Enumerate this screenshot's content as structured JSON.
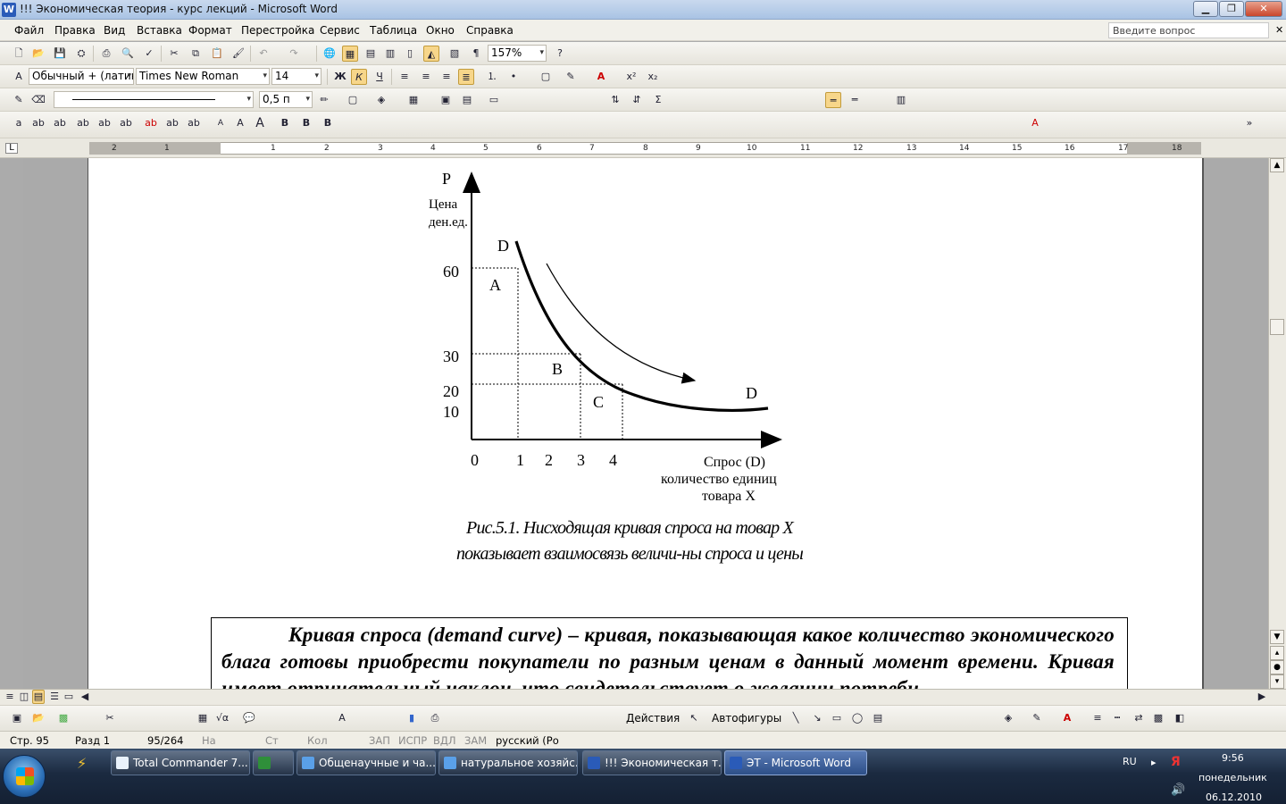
{
  "window": {
    "title": "!!! Экономическая теория - курс лекций - Microsoft Word",
    "app_icon": "W"
  },
  "menu": {
    "items": [
      "Файл",
      "Правка",
      "Вид",
      "Вставка",
      "Формат",
      "Перестройка",
      "Сервис",
      "Таблица",
      "Окно",
      "Справка"
    ],
    "help_placeholder": "Введите вопрос"
  },
  "toolbar": {
    "zoom": "157%",
    "style": "Обычный + (латин",
    "font": "Times New Roman",
    "size": "14",
    "line_width": "0,5 п"
  },
  "figure": {
    "p_label": "P",
    "price_label_1": "Цена",
    "price_label_2": "ден.ед.",
    "curve_label_top": "D",
    "curve_label_bottom": "D",
    "area_a": "A",
    "area_b": "B",
    "area_c": "C",
    "y_ticks": [
      "60",
      "30",
      "20",
      "10"
    ],
    "x_ticks": [
      "0",
      "1",
      "2",
      "3",
      "4"
    ],
    "x_label_1": "Спрос (D)",
    "x_label_2": "количество единиц",
    "x_label_3": "товара X",
    "caption": "Рис.5.1. Нисходящая кривая спроса на товар X показывает взаимосвязь величи-ны спроса и цены"
  },
  "definition": {
    "text": "Кривая спроса (demand curve) – кривая, показывающая какое количество экономического блага готовы приобрести покупатели по разным ценам в данный момент времени. Кривая имеет отрицательный наклон, что свидетельствует о желании потреби-"
  },
  "drawbar": {
    "actions": "Действия",
    "autoshapes": "Автофигуры"
  },
  "status": {
    "page": "Стр. 95",
    "section": "Разд 1",
    "pages": "95/264",
    "at": "На",
    "line": "Ст",
    "col": "Кол",
    "rec": "ЗАП",
    "trk": "ИСПР",
    "ext": "ВДЛ",
    "ovr": "ЗАМ",
    "lang": "русский (Ро"
  },
  "taskbar": {
    "buttons": [
      "Total Commander 7....",
      "Общенаучные и ча...",
      "натуральное хозяйс...",
      "!!! Экономическая т...",
      "ЭТ - Microsoft Word"
    ],
    "lang": "RU",
    "time": "9:56",
    "day": "понедельник",
    "date": "06.12.2010"
  }
}
